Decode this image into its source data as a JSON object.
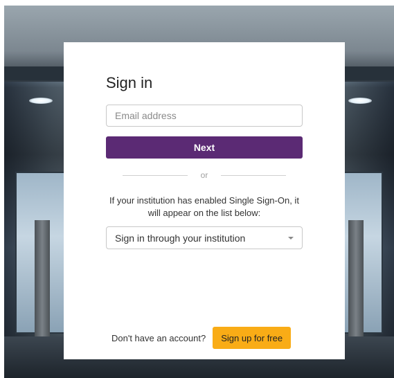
{
  "signin": {
    "title": "Sign in",
    "email_placeholder": "Email address",
    "next_label": "Next",
    "divider_text": "or",
    "sso_text": "If your institution has enabled Single Sign-On, it will appear on the list below:",
    "sso_select_label": "Sign in through your institution"
  },
  "footer": {
    "prompt": "Don't have an account?",
    "signup_label": "Sign up for free"
  },
  "colors": {
    "primary": "#5b2a74",
    "accent": "#f9ac16"
  }
}
